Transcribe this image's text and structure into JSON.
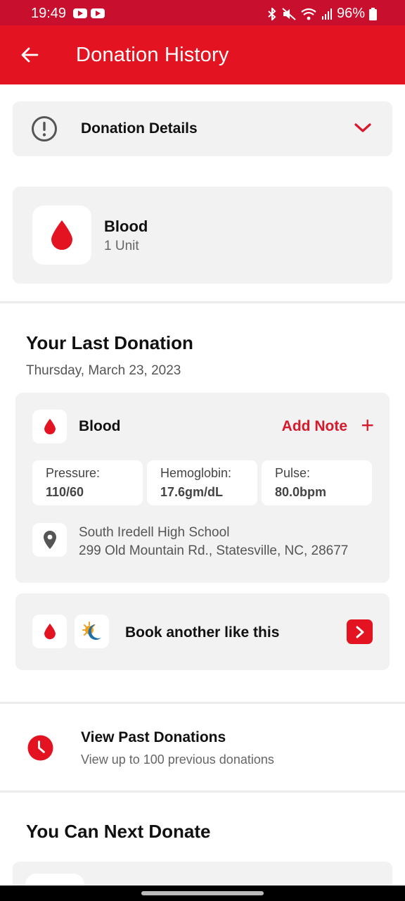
{
  "status_bar": {
    "time": "19:49",
    "battery": "96%"
  },
  "app_bar": {
    "title": "Donation History"
  },
  "details": {
    "label": "Donation Details"
  },
  "blood_summary": {
    "title": "Blood",
    "units": "1 Unit"
  },
  "last_donation": {
    "heading": "Your Last Donation",
    "date": "Thursday, March 23, 2023",
    "type": "Blood",
    "add_note": "Add Note",
    "stats": [
      {
        "label": "Pressure:",
        "value": "110/60"
      },
      {
        "label": "Hemoglobin:",
        "value": "17.6gm/dL"
      },
      {
        "label": "Pulse:",
        "value": "80.0bpm"
      }
    ],
    "location_name": "South Iredell High School",
    "location_address": "299 Old Mountain Rd., Statesville, NC, 28677"
  },
  "book": {
    "label": "Book another like this"
  },
  "past": {
    "title": "View Past Donations",
    "subtitle": "View up to 100 previous donations"
  },
  "next": {
    "heading": "You Can Next Donate"
  },
  "colors": {
    "brand_red": "#e31321",
    "card_bg": "#f2f2f2"
  }
}
